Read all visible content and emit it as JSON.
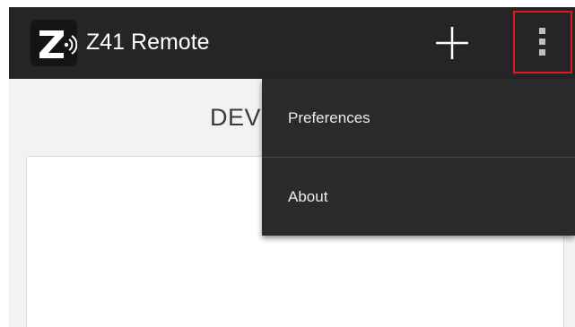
{
  "action_bar": {
    "app_title": "Z41 Remote",
    "app_icon": "z41-logo-icon",
    "add_button_icon": "plus-icon",
    "overflow_button_icon": "vertical-ellipsis-icon",
    "background": "#252525",
    "highlight_color": "#e0181e"
  },
  "main": {
    "heading": "DEV"
  },
  "overflow_menu": {
    "items": [
      {
        "label": "Preferences"
      },
      {
        "label": "About"
      }
    ],
    "background": "#2a2a2a"
  }
}
